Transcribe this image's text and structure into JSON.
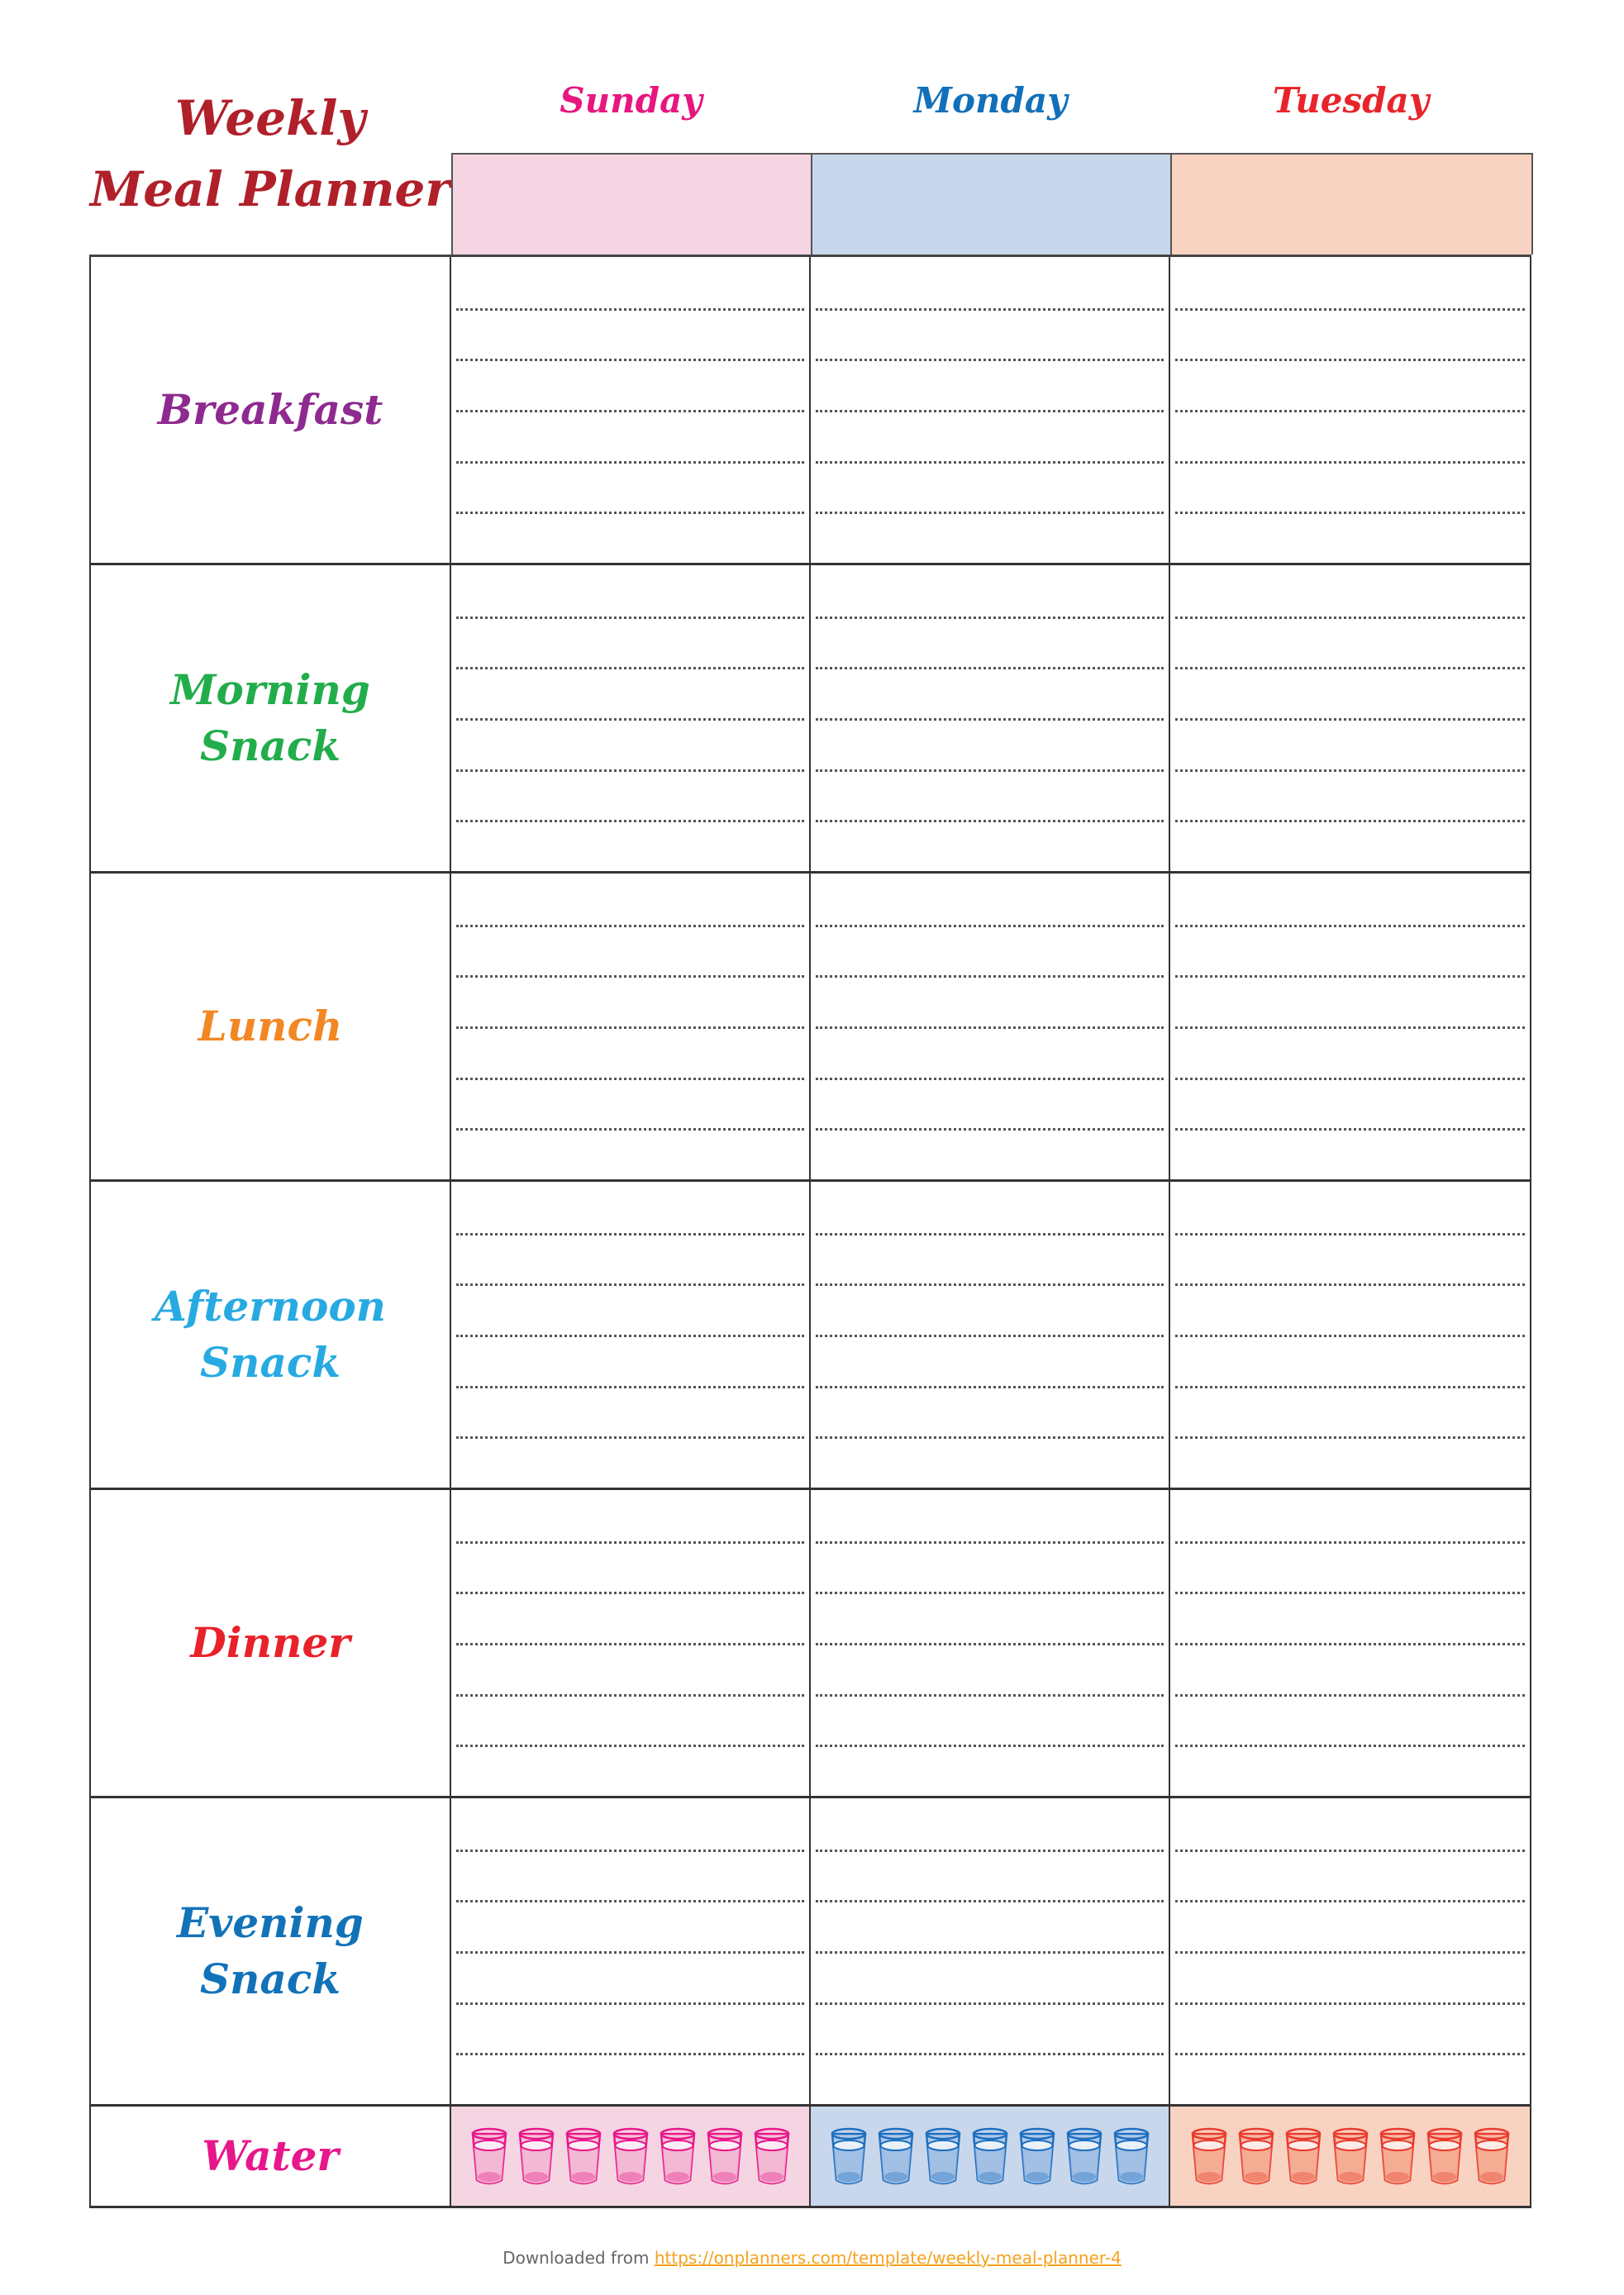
{
  "title": {
    "line1": "Weekly",
    "line2": "Meal Planner",
    "color": "#b0202a"
  },
  "days": [
    {
      "name": "Sunday",
      "text_color": "#e8167f",
      "band_color": "#f6d5e3",
      "glass_color": "#e8178a",
      "glass_fill": "#f3b6d1"
    },
    {
      "name": "Monday",
      "text_color": "#1170b9",
      "band_color": "#c8d7ec",
      "glass_color": "#1e6fc0",
      "glass_fill": "#9fbde3"
    },
    {
      "name": "Tuesday",
      "text_color": "#e8242b",
      "band_color": "#f9d3c1",
      "glass_color": "#ea3a2e",
      "glass_fill": "#f4a98f"
    }
  ],
  "meals": [
    {
      "line1": "Breakfast",
      "line2": "",
      "color": "#8e2a8f"
    },
    {
      "line1": "Morning",
      "line2": "Snack",
      "color": "#22ad4b"
    },
    {
      "line1": "Lunch",
      "line2": "",
      "color": "#f28724"
    },
    {
      "line1": "Afternoon",
      "line2": "Snack",
      "color": "#27aae1"
    },
    {
      "line1": "Dinner",
      "line2": "",
      "color": "#e8222b"
    },
    {
      "line1": "Evening",
      "line2": "Snack",
      "color": "#1272b8"
    }
  ],
  "water": {
    "label": "Water",
    "color": "#e8168b",
    "glasses_per_day": 7
  },
  "writing_lines_per_cell": 5,
  "footer": {
    "prefix": "Downloaded from",
    "link_text": "https://onplanners.com/template/weekly-meal-planner-4"
  }
}
